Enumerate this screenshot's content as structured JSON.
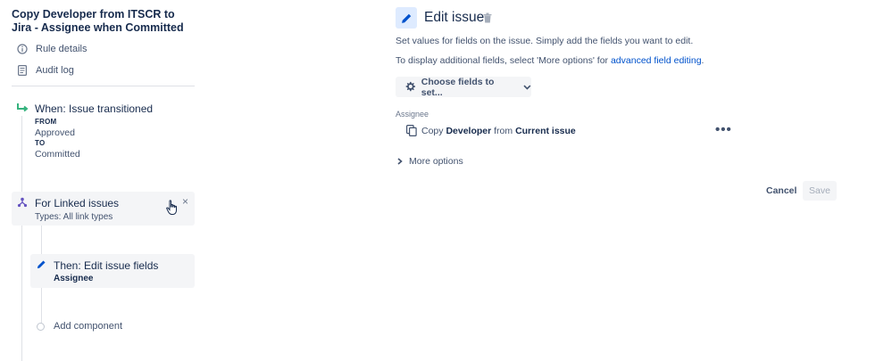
{
  "rule": {
    "title": "Copy Developer from ITSCR to Jira - Assignee when Committed"
  },
  "nav": {
    "rule_details": "Rule details",
    "audit_log": "Audit log"
  },
  "trigger": {
    "title": "When: Issue transitioned",
    "from_label": "FROM",
    "from_value": "Approved",
    "to_label": "TO",
    "to_value": "Committed"
  },
  "branch": {
    "title": "For Linked issues",
    "subtitle": "Types: All link types",
    "close_glyph": "×"
  },
  "action": {
    "title": "Then: Edit issue fields",
    "subtitle": "Assignee"
  },
  "add_component": "Add component",
  "editor": {
    "title": "Edit issue",
    "description": "Set values for fields on the issue. Simply add the fields you want to edit.",
    "hint_prefix": "To display additional fields, select 'More options' for ",
    "hint_link": "advanced field editing",
    "hint_suffix": ".",
    "choose_fields": "Choose fields to set...",
    "field_label": "Assignee",
    "copy": {
      "prefix": "Copy ",
      "field": "Developer",
      "middle": " from ",
      "source": "Current issue"
    },
    "more_dots": "•••",
    "more_options": "More options",
    "cancel": "Cancel",
    "save": "Save"
  },
  "colors": {
    "accent": "#0052cc",
    "trigger_icon": "#36b37e",
    "branch_icon": "#6554c0",
    "action_icon": "#0052cc",
    "panel_bg": "#f4f5f7",
    "header_icon_bg": "#deebff"
  },
  "icons": {
    "rule_details": "info-icon",
    "audit_log": "document-icon",
    "trigger": "transition-icon",
    "branch": "branch-icon",
    "action": "pencil-icon",
    "header": "pencil-icon",
    "trash": "trash-icon",
    "choose": "gear-icon",
    "copy": "copy-icon"
  }
}
